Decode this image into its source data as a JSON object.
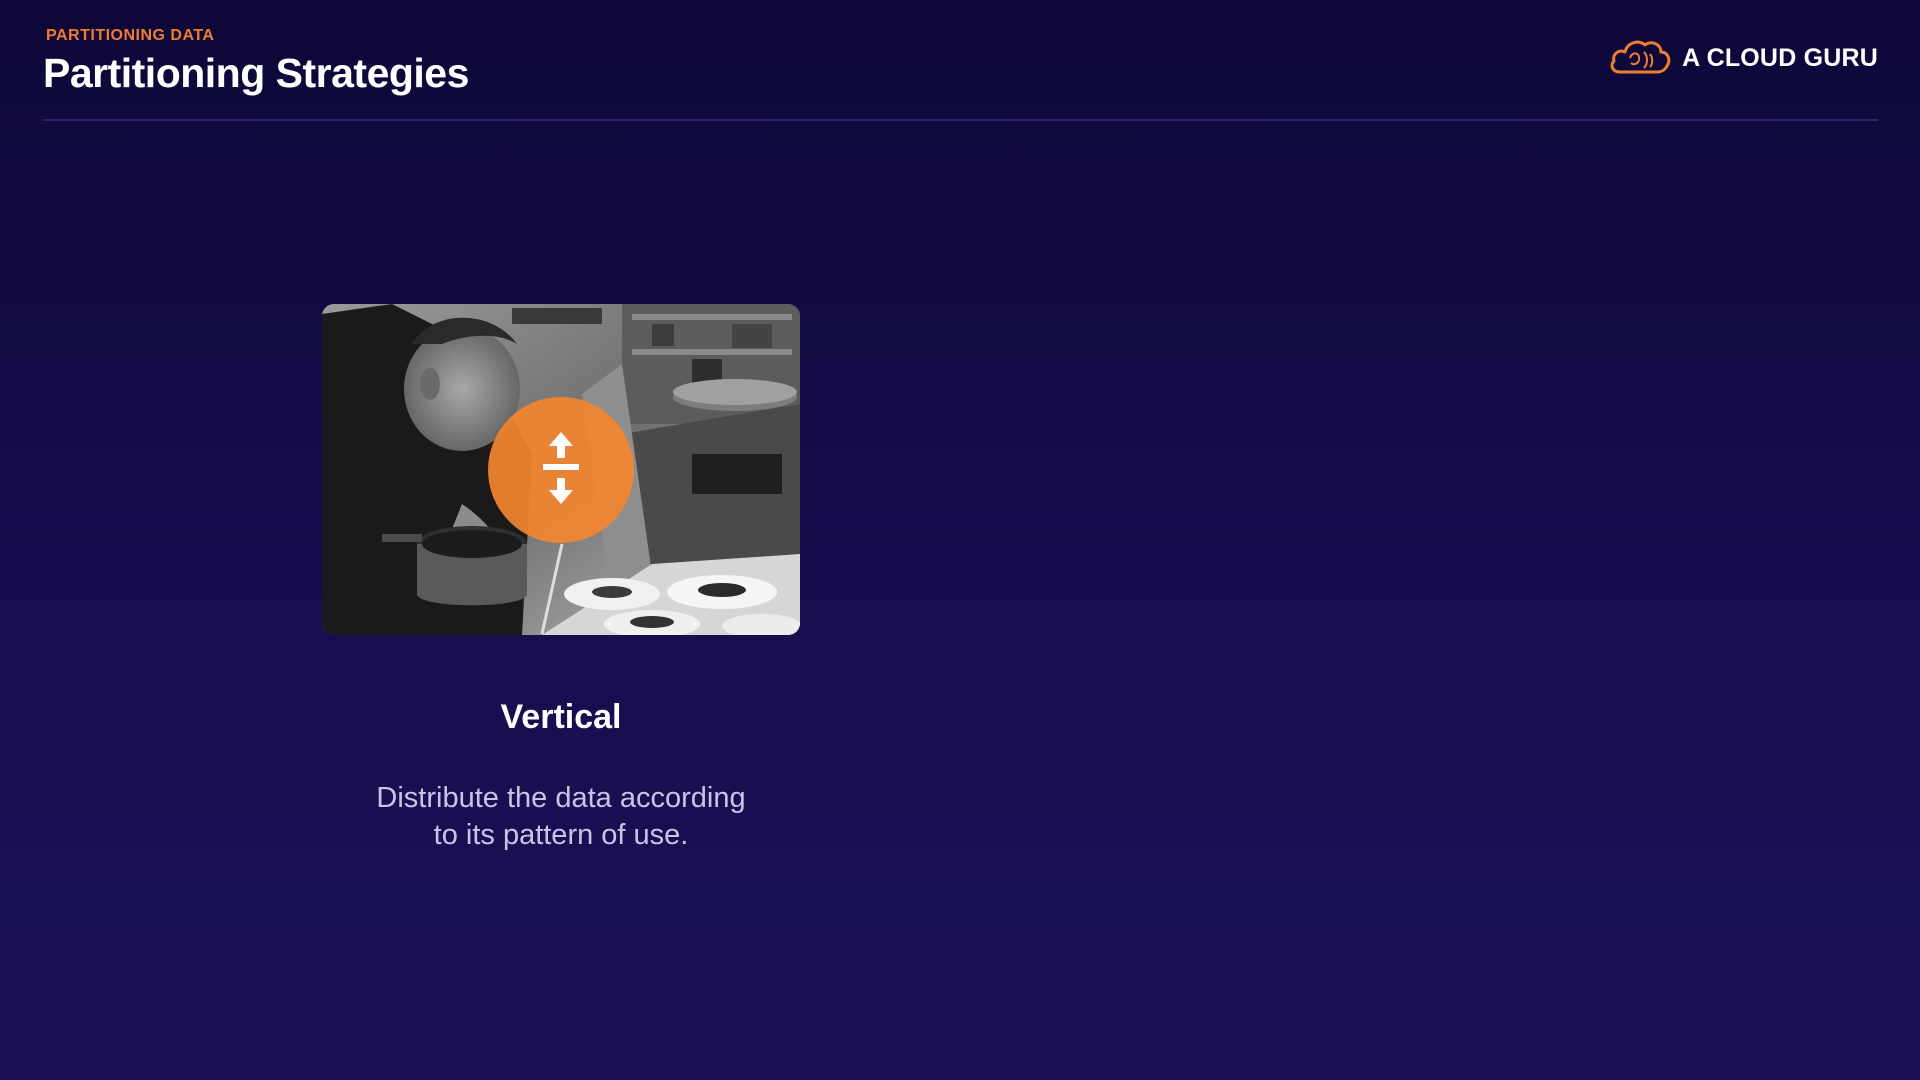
{
  "header": {
    "eyebrow": "PARTITIONING DATA",
    "title": "Partitioning Strategies"
  },
  "logo": {
    "text": "A CLOUD GURU",
    "icon": "cloud-icon",
    "accent_color": "#f07c2f"
  },
  "card": {
    "image_alt": "Chef plating dishes in a kitchen",
    "badge_icon": "vertical-split-icon",
    "badge_color": "#f28530",
    "heading": "Vertical",
    "description_lines": [
      "Distribute the data according",
      "to its pattern of use."
    ]
  }
}
